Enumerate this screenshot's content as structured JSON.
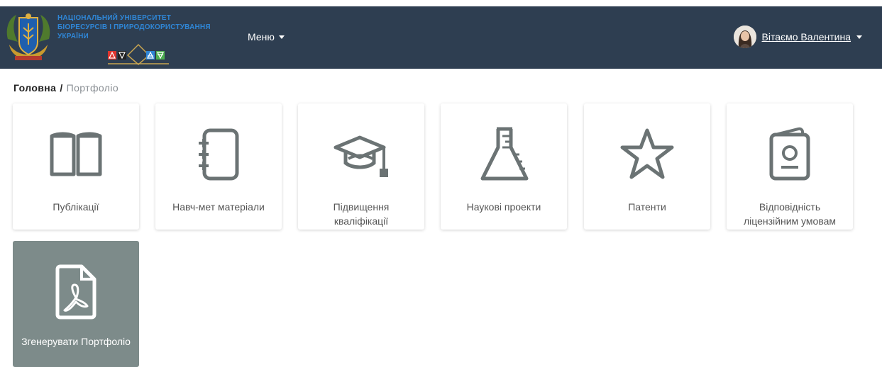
{
  "header": {
    "university_lines": [
      "НАЦІОНАЛЬНИЙ УНІВЕРСИТЕТ",
      "БІОРЕСУРСІВ І ПРИРОДОКОРИСТУВАННЯ",
      "УКРАЇНИ"
    ],
    "menu_label": "Меню",
    "greeting": "Вітаємо Валентина",
    "colors": {
      "background": "#2e3e51",
      "university_text": "#2f86d6"
    }
  },
  "breadcrumb": {
    "home": "Головна",
    "separator": "/",
    "current": "Портфоліо"
  },
  "cards": [
    {
      "label": "Публікації",
      "icon": "open-book-icon"
    },
    {
      "label": "Навч-мет матеріали",
      "icon": "notebook-icon"
    },
    {
      "label": "Підвищення кваліфікації",
      "icon": "graduation-cap-icon"
    },
    {
      "label": "Наукові проекти",
      "icon": "flask-icon"
    },
    {
      "label": "Патенти",
      "icon": "star-icon"
    },
    {
      "label": "Відповідність ліцензійним умовам",
      "icon": "id-card-icon"
    },
    {
      "label": "Згенерувати Портфоліо",
      "icon": "pdf-file-icon"
    }
  ],
  "colors": {
    "icon": "#6b7374",
    "generate_card": "#7d8b8a"
  }
}
